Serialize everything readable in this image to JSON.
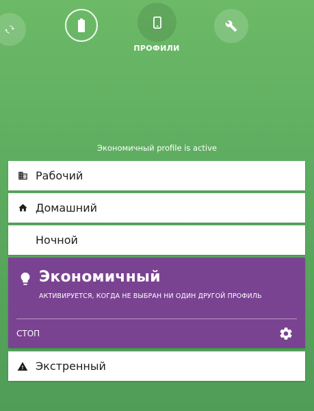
{
  "nav": {
    "items": [
      {
        "icon": "sync-icon"
      },
      {
        "icon": "battery-icon"
      },
      {
        "icon": "phone-icon",
        "label": "ПРОФИЛИ"
      },
      {
        "icon": "wrench-icon"
      }
    ]
  },
  "status": {
    "text": "Экономичный profile is active"
  },
  "profiles": {
    "items": [
      {
        "label": "Рабочий",
        "icon": "building-icon"
      },
      {
        "label": "Домашний",
        "icon": "home-icon"
      },
      {
        "label": "Ночной",
        "icon": "moon-icon"
      },
      {
        "label": "Экстренный",
        "icon": "warning-icon"
      }
    ],
    "active": {
      "title": "Экономичный",
      "icon": "lightbulb-icon",
      "description": "АКТИВИРУЕТСЯ, КОГДА НЕ ВЫБРАН НИ ОДИН ДРУГОЙ ПРОФИЛЬ",
      "stop_label": "СТОП",
      "settings_icon": "gear-icon",
      "color": "#7a4391"
    }
  },
  "colors": {
    "background": "#5fae60",
    "card": "#ffffff",
    "active": "#7a4391"
  }
}
